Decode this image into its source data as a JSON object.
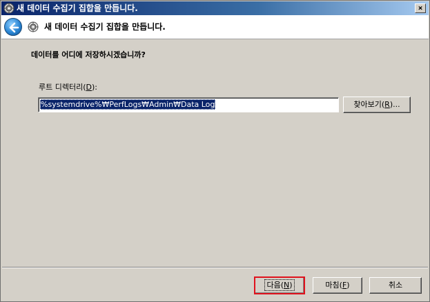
{
  "window": {
    "title": "새 데이터 수집기 집합을 만듭니다.",
    "close_label": "×"
  },
  "header": {
    "title": "새 데이터 수집기 집합을 만듭니다."
  },
  "content": {
    "question": "데이터를 어디에 저장하시겠습니까?",
    "root_dir_label_prefix": "루트 디렉터리(",
    "root_dir_label_mnemonic": "D",
    "root_dir_label_suffix": "):",
    "root_dir_value": "%systemdrive%₩PerfLogs₩Admin₩Data Log"
  },
  "buttons": {
    "browse_prefix": "찾아보기(",
    "browse_mnemonic": "R",
    "browse_suffix": ")...",
    "next_prefix": "다음(",
    "next_mnemonic": "N",
    "next_suffix": ")",
    "finish_prefix": "마침(",
    "finish_mnemonic": "F",
    "finish_suffix": ")",
    "cancel": "취소"
  },
  "colors": {
    "selection": "#0a246a",
    "highlight_border": "#e0111c",
    "dialog_bg": "#d4d0c8"
  },
  "icons": {
    "title_icon": "collector-set-icon",
    "back": "back-arrow-icon",
    "header_icon": "collector-set-icon"
  }
}
